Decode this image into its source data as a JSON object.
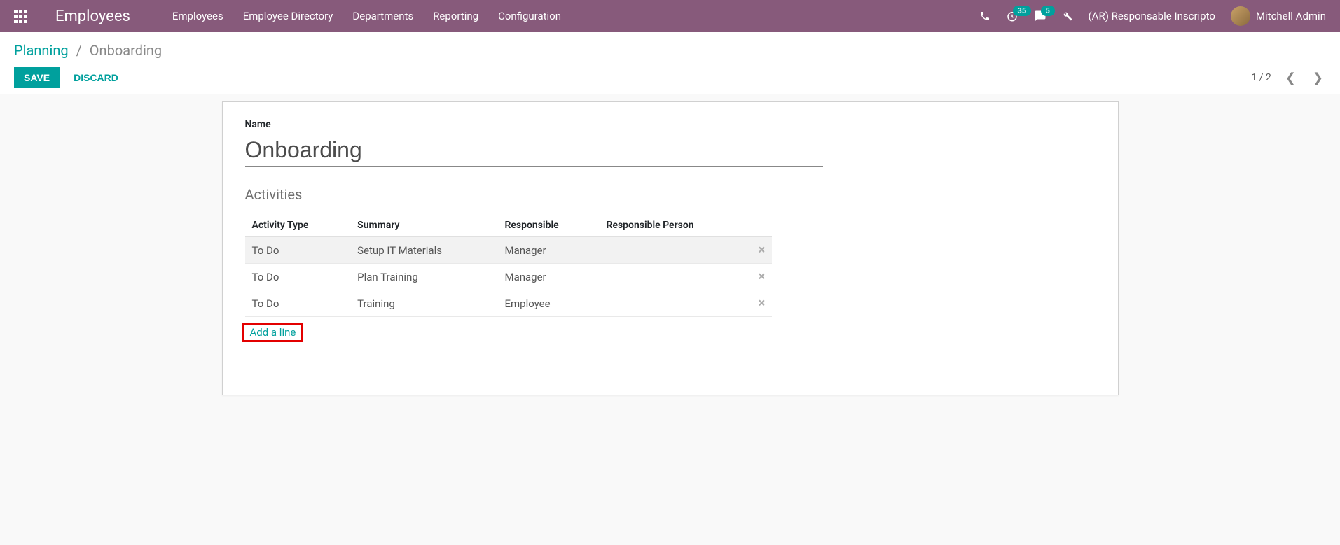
{
  "topbar": {
    "brand": "Employees",
    "nav": [
      "Employees",
      "Employee Directory",
      "Departments",
      "Reporting",
      "Configuration"
    ],
    "timer_badge": "35",
    "msg_badge": "5",
    "company": "(AR) Responsable Inscripto",
    "user": "Mitchell Admin"
  },
  "breadcrumb": {
    "parent": "Planning",
    "current": "Onboarding"
  },
  "buttons": {
    "save": "SAVE",
    "discard": "DISCARD"
  },
  "pager": {
    "text": "1 / 2"
  },
  "form": {
    "name_label": "Name",
    "name_value": "Onboarding",
    "section_title": "Activities",
    "columns": {
      "activity_type": "Activity Type",
      "summary": "Summary",
      "responsible": "Responsible",
      "responsible_person": "Responsible Person"
    },
    "rows": [
      {
        "type": "To Do",
        "summary": "Setup IT Materials",
        "responsible": "Manager",
        "person": ""
      },
      {
        "type": "To Do",
        "summary": "Plan Training",
        "responsible": "Manager",
        "person": ""
      },
      {
        "type": "To Do",
        "summary": "Training",
        "responsible": "Employee",
        "person": ""
      }
    ],
    "add_line": "Add a line"
  }
}
